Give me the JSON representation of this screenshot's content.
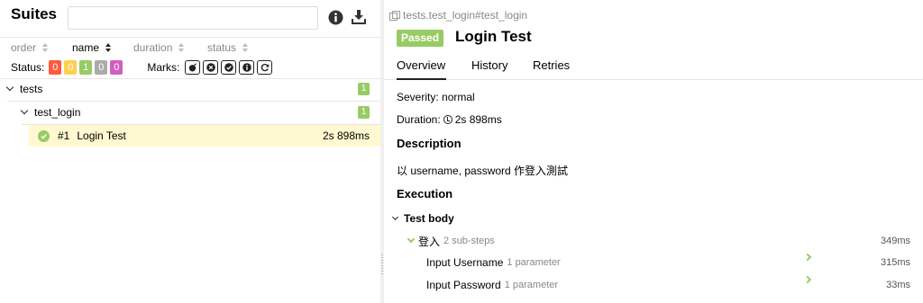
{
  "left": {
    "title": "Suites",
    "search": {
      "value": "",
      "placeholder": ""
    },
    "sort": [
      {
        "label": "order",
        "active": false
      },
      {
        "label": "name",
        "active": true
      },
      {
        "label": "duration",
        "active": false
      },
      {
        "label": "status",
        "active": false
      }
    ],
    "status_label": "Status:",
    "status_counts": [
      {
        "value": "0",
        "color": "#fd5a3e"
      },
      {
        "value": "0",
        "color": "#ffd050"
      },
      {
        "value": "1",
        "color": "#97cc64"
      },
      {
        "value": "0",
        "color": "#aaaaaa"
      },
      {
        "value": "0",
        "color": "#d35ebe"
      }
    ],
    "marks_label": "Marks:",
    "marks": [
      "bomb-icon",
      "close-circle-icon",
      "check-circle-icon",
      "info-circle-icon",
      "refresh-icon"
    ],
    "tree": {
      "root_label": "tests",
      "root_count": "1",
      "child_label": "test_login",
      "child_count": "1",
      "test_order": "#1",
      "test_name": "Login Test",
      "test_duration": "2s 898ms"
    }
  },
  "right": {
    "breadcrumb": "tests.test_login#test_login",
    "status": "Passed",
    "title": "Login Test",
    "tabs": [
      "Overview",
      "History",
      "Retries"
    ],
    "severity": "Severity: normal",
    "duration_label": "Duration:",
    "duration_value": "2s 898ms",
    "description_heading": "Description",
    "description_text": "以 username, password 作登入測試",
    "execution_heading": "Execution",
    "test_body_label": "Test body",
    "steps": {
      "login": {
        "name": "登入",
        "sub": "2 sub-steps",
        "duration": "349ms"
      },
      "username": {
        "name": "Input Username",
        "sub": "1 parameter",
        "duration": "315ms"
      },
      "password": {
        "name": "Input Password",
        "sub": "1 parameter",
        "duration": "33ms"
      }
    }
  },
  "colors": {
    "passed": "#97cc64",
    "selected_row": "#fff8d0"
  }
}
